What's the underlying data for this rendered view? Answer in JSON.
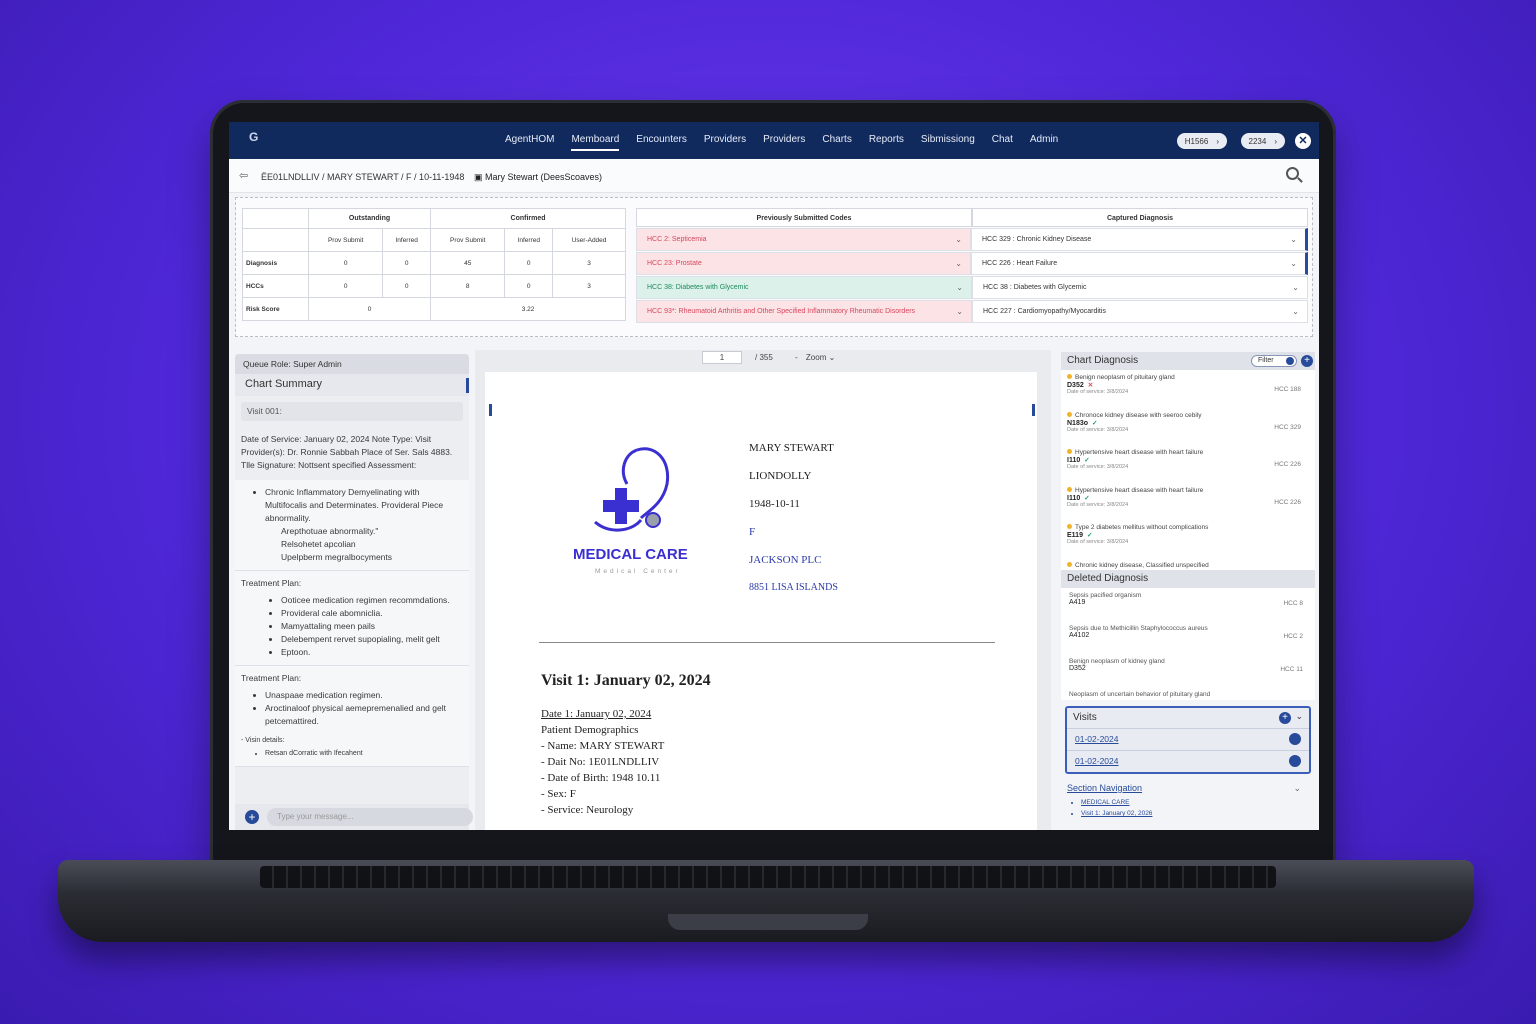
{
  "nav": {
    "items": [
      "AgentHOM",
      "Memboard",
      "Encounters",
      "Providers",
      "Providers",
      "Charts",
      "Reports",
      "Sibmissiong",
      "Chat",
      "Admin"
    ],
    "active_index": 1,
    "pill1": "H1566",
    "pill2": "2234",
    "pill_arrow": "›",
    "close": "✕"
  },
  "crumb": {
    "back": "⇦",
    "path": "ЁE01LNDLLIV / MARY STEWART / F / 10-11-1948",
    "doc": "▣ Mary Stewart (DeesScoaves)"
  },
  "stats": {
    "h_outstanding": "Outstanding",
    "h_confirmed": "Confirmed",
    "cols": [
      "Prov Submit",
      "Inferred",
      "Prov Submit",
      "Inferred",
      "User-Added"
    ],
    "rows": [
      {
        "label": "Diagnosis",
        "v": [
          "0",
          "0",
          "45",
          "0",
          "3"
        ]
      },
      {
        "label": "HCCs",
        "v": [
          "0",
          "0",
          "8",
          "0",
          "3"
        ]
      }
    ],
    "risk_label": "Risk Score",
    "risk_a": "0",
    "risk_b": "3.22"
  },
  "codes": {
    "h_prev": "Previously Submitted Codes",
    "h_captured": "Captured Diagnosis",
    "prev": [
      "HCC 2: Septicemia",
      "HCC 23: Prostate",
      "HCC 38: Diabetes with Glycemic",
      "HCC 93*: Rheumatoid Arthritis and Other Specified Inflammatory Rheumatic Disorders"
    ],
    "captured": [
      "HCC 329 : Chronic Kidney Disease",
      "HCC 226 : Heart Failure",
      "HCC 38 : Diabetes with Glycemic",
      "HCC 227 : Cardiomyopathy/Myocarditis"
    ],
    "chev": "⌄"
  },
  "left": {
    "queue": "Queue Role: Super Admin",
    "title": "Chart Summary",
    "visit": "Visit 001:",
    "dos_text": "Date of Service: January 02, 2024 Note Type: Visit Provider(s): Dr. Ronnie Sabbah Place of Ser. Sals 4883. Tlle Signature: Nottsent specified Assessment:",
    "assess": [
      "Chronic Inflammatory Demyelinating with Multifocalis and Determinates. Provideral Piece abnormality."
    ],
    "assess_sub": [
      "Arepthotuae abnormality.\"",
      "Relsohetet apcolian",
      "Upelpberm megralbocyments"
    ],
    "tp1_label": "Treatment Plan:",
    "tp1": [
      "Ooticee medication regimen recommdations.",
      "Provideral cale abomniclia.",
      "Mamyattaling meen pails",
      "Delebempent rervet supopialing, melit gelt",
      "Eptoon."
    ],
    "tp2_label": "Treatment Plan:",
    "tp2": [
      "Unaspaae medication regimen.",
      "Aroctinaloof physical aemepremenalied and gelt petcemattired."
    ],
    "vd_label": "- Visin details:",
    "vd": [
      "Retsan dCorratic with Ifecahent"
    ],
    "plus": "+",
    "msg_placeholder": "Type your message..."
  },
  "viewer": {
    "page": "1",
    "total": "/ 355",
    "dash": "-",
    "zoom": "Zoom ⌄",
    "logo_name": "MEDICAL CARE",
    "logo_sub": "Medical Center",
    "p_name": "MARY STEWART",
    "p_id": "LIONDOLLY",
    "p_dob": "1948-10-11",
    "p_sex": "F",
    "p_org": "JACKSON PLC",
    "p_addr": "8851 LISA ISLANDS",
    "visit_h": "Visit 1: January 02, 2024",
    "date_line": "Date 1: January 02, 2024",
    "demo": "Patient Demographics",
    "lines": [
      "- Name: MARY STEWART",
      "- Dait No: 1E01LNDLLIV",
      "- Date of Birth: 1948 10.11",
      "- Sex: F",
      "- Service: Neurology"
    ]
  },
  "right": {
    "dx_title": "Chart Diagnosis",
    "filter": "Filter",
    "add": "+",
    "dx": [
      {
        "desc": "Benign neoplasm of pituitary gland",
        "code": "D352",
        "mark": "✕",
        "ok": false,
        "dos": "Date of service: 3/8/2024",
        "hcc": "HCC 188"
      },
      {
        "desc": "Chronoce kidney disease with seeroo cebily",
        "code": "N183o",
        "mark": "✓",
        "ok": true,
        "dos": "Date of service: 3/8/2024",
        "hcc": "HCC 329"
      },
      {
        "desc": "Hypertensive heart disease with heart failure",
        "code": "I110",
        "mark": "✓",
        "ok": true,
        "dos": "Date of service: 3/8/2024",
        "hcc": "HCC 226"
      },
      {
        "desc": "Hypertensive heart disease with heart failure",
        "code": "I110",
        "mark": "✓",
        "ok": true,
        "dos": "Date of service: 3/8/2024",
        "hcc": "HCC 226"
      },
      {
        "desc": "Type 2 diabetes mellitus without complications",
        "code": "E119",
        "mark": "✓",
        "ok": true,
        "dos": "Date of service: 3/8/2024",
        "hcc": ""
      }
    ],
    "dx_last": "Chronic kidney disease, Classified unspecified",
    "del_title": "Deleted Diagnosis",
    "del": [
      {
        "desc": "Sepsis pacified organism",
        "code": "A419",
        "hcc": "HCC 8"
      },
      {
        "desc": "Sepsis due to Methicillin Staphylococcus aureus",
        "code": "A4102",
        "hcc": "HCC 2"
      },
      {
        "desc": "Benign neoplasm of kidney gland",
        "code": "D352",
        "hcc": "HCC 11"
      }
    ],
    "del_last": "Neoplasm of uncertain behavior of pituitary gland",
    "visits_title": "Visits",
    "visits": [
      "01-02-2024",
      "01-02-2024"
    ],
    "sec_title": "Section Navigation",
    "sec_items": [
      "MEDICAL CARE",
      "Visit 1: January 02, 2026"
    ],
    "cv": "⌄"
  }
}
